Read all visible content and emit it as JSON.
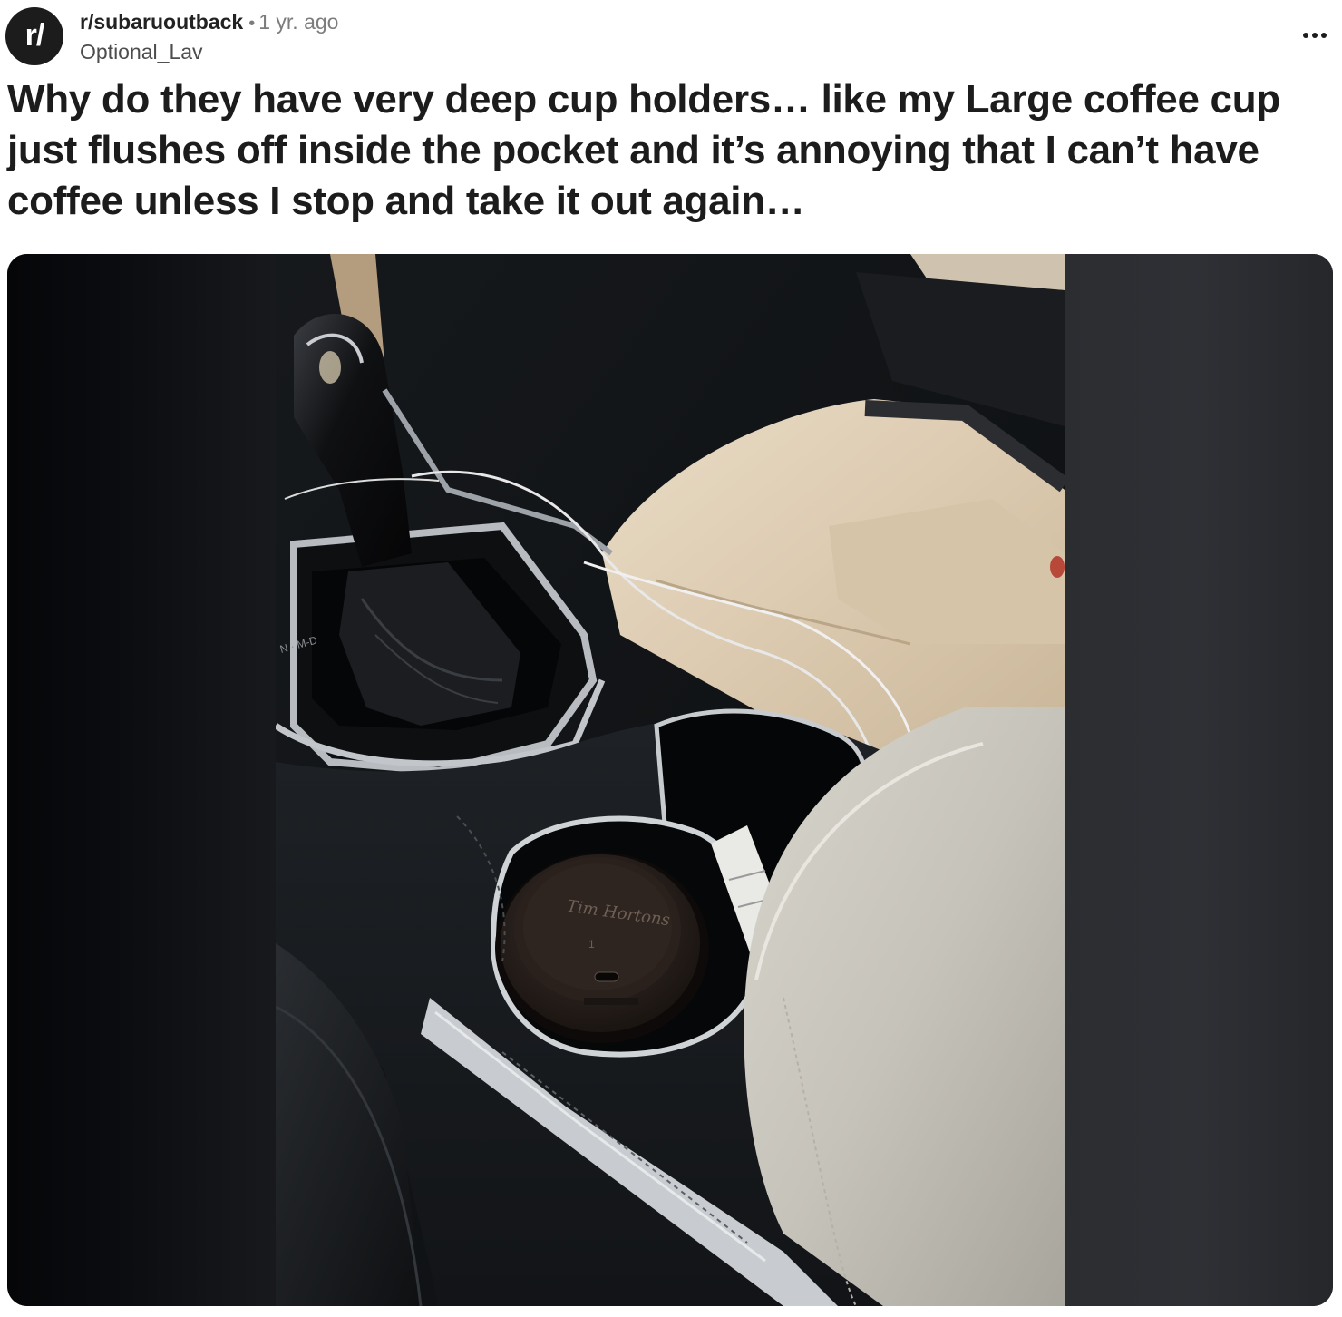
{
  "post": {
    "avatar_text": "r/",
    "subreddit": "r/subaruoutback",
    "separator": "•",
    "time": "1 yr. ago",
    "author": "Optional_Lav",
    "more_icon": "more-horizontal-icon",
    "title": "Why do they have very deep cup holders… like my Large coffee cup just flushes off inside the pocket and it’s annoying that I can’t have coffee unless I stop and take it out again…"
  },
  "image": {
    "lid_brand": "Tim Hortons",
    "lid_number": "1",
    "gear_labels": "N · M-D"
  },
  "colors": {
    "text": "#1c1c1c",
    "muted": "#7c7c7c",
    "avatar_bg": "#1c1c1c"
  }
}
